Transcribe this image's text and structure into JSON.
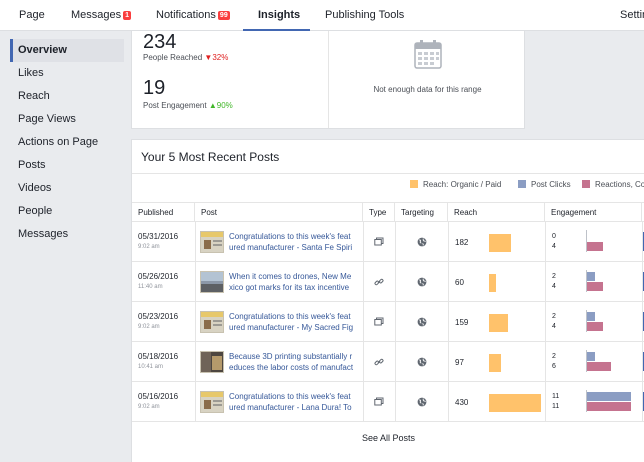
{
  "topnav": {
    "items": [
      {
        "label": "Page"
      },
      {
        "label": "Messages",
        "badge": "1"
      },
      {
        "label": "Notifications",
        "badge": "99"
      },
      {
        "label": "Insights"
      },
      {
        "label": "Publishing Tools"
      },
      {
        "label": "Settings"
      }
    ]
  },
  "sidebar": {
    "items": [
      {
        "label": "Overview"
      },
      {
        "label": "Likes"
      },
      {
        "label": "Reach"
      },
      {
        "label": "Page Views"
      },
      {
        "label": "Actions on Page"
      },
      {
        "label": "Posts"
      },
      {
        "label": "Videos"
      },
      {
        "label": "People"
      },
      {
        "label": "Messages"
      }
    ]
  },
  "stats": {
    "reach": {
      "value": "234",
      "label": "People Reached",
      "change": "32%"
    },
    "engagement": {
      "value": "19",
      "label": "Post Engagement",
      "change": "90%"
    },
    "no_data": "Not enough data for this range"
  },
  "posts": {
    "title": "Your 5 Most Recent Posts",
    "legend": [
      {
        "label": "Reach: Organic / Paid",
        "color": "#ffc26b"
      },
      {
        "label": "Post Clicks",
        "color": "#8b9dc3"
      },
      {
        "label": "Reactions, Co",
        "color": "#c5738f"
      }
    ],
    "columns": [
      "Published",
      "Post",
      "Type",
      "Targeting",
      "Reach",
      "Engagement"
    ],
    "rows": [
      {
        "date": "05/31/2016",
        "time": "9:02 am",
        "text1": "Congratulations to this week's feat",
        "text2": "ured manufacturer - Santa Fe Spiri",
        "type_icon": "link-icon",
        "reach": "182",
        "reach_fraction": 0.42,
        "clicks": "0",
        "reactions": "4",
        "clicks_fraction": 0.0,
        "reactions_fraction": 0.36
      },
      {
        "date": "05/26/2016",
        "time": "11:40 am",
        "text1": "When it comes to drones, New Me",
        "text2": "xico got marks for its tax incentive",
        "type_icon": "link-icon",
        "reach": "60",
        "reach_fraction": 0.14,
        "clicks": "2",
        "reactions": "4",
        "clicks_fraction": 0.18,
        "reactions_fraction": 0.36
      },
      {
        "date": "05/23/2016",
        "time": "9:02 am",
        "text1": "Congratulations to this week's feat",
        "text2": "ured manufacturer - My Sacred Fig",
        "type_icon": "link-icon",
        "reach": "159",
        "reach_fraction": 0.37,
        "clicks": "2",
        "reactions": "4",
        "clicks_fraction": 0.18,
        "reactions_fraction": 0.36
      },
      {
        "date": "05/18/2016",
        "time": "10:41 am",
        "text1": "Because 3D printing substantially r",
        "text2": "educes the labor costs of manufact",
        "type_icon": "link-icon",
        "reach": "97",
        "reach_fraction": 0.23,
        "clicks": "2",
        "reactions": "6",
        "clicks_fraction": 0.18,
        "reactions_fraction": 0.55
      },
      {
        "date": "05/16/2016",
        "time": "9:02 am",
        "text1": "Congratulations to this week's feat",
        "text2": "ured manufacturer - Lana Dura! To",
        "type_icon": "link-icon",
        "reach": "430",
        "reach_fraction": 1.0,
        "clicks": "11",
        "reactions": "11",
        "clicks_fraction": 1.0,
        "reactions_fraction": 1.0
      }
    ],
    "see_all": "See All Posts"
  },
  "colors": {
    "accent": "#4267b2",
    "reach": "#ffc26b",
    "clicks": "#8b9dc3",
    "reactions": "#c5738f",
    "negative": "#e02020",
    "positive": "#42b72a"
  }
}
